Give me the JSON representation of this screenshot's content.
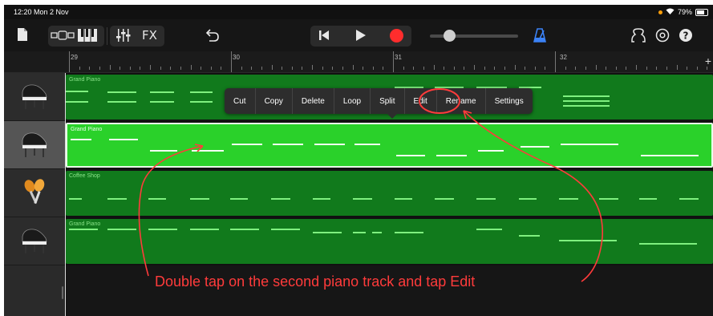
{
  "status_bar": {
    "time_date": "12:20  Mon 2 Nov",
    "battery": "79%",
    "battery_level": 0.79
  },
  "toolbar": {
    "fx_label": "FX",
    "slider_level": 0.22,
    "icons": [
      "document-icon",
      "track-view-icon",
      "keyboard-icon",
      "mixer-icon",
      "undo-icon",
      "rewind-icon",
      "play-icon",
      "record-icon",
      "metronome-icon",
      "loop-browser-icon",
      "settings-icon",
      "help-icon"
    ]
  },
  "timeline": {
    "bars": [
      "29",
      "30",
      "31",
      "32"
    ]
  },
  "tracks": [
    {
      "region_name": "Grand Piano",
      "instrument_icon": "grand-piano-icon",
      "selected": false
    },
    {
      "region_name": "Grand Piano",
      "instrument_icon": "grand-piano-icon",
      "selected": true
    },
    {
      "region_name": "Coffee Shop",
      "instrument_icon": "maracas-icon",
      "selected": false
    },
    {
      "region_name": "Grand Piano",
      "instrument_icon": "grand-piano-icon",
      "selected": false
    }
  ],
  "context_menu": {
    "items": [
      "Cut",
      "Copy",
      "Delete",
      "Loop",
      "Split",
      "Edit",
      "Rename",
      "Settings"
    ],
    "highlighted": "Edit"
  },
  "annotation": {
    "caption": "Double tap on the second piano track and tap Edit",
    "color": "#ff3b3b"
  },
  "colors": {
    "region": "#117a1c",
    "region_selected": "#2ad12a",
    "record": "#ff2d2d",
    "metronome": "#3b82f6"
  }
}
